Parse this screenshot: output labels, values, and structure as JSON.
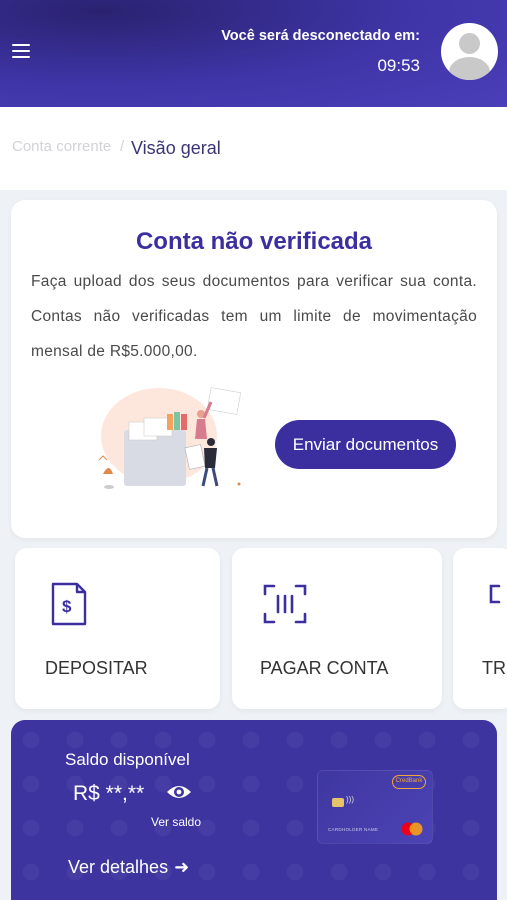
{
  "header": {
    "logout_label": "Você será desconectado em:",
    "timer": "09:53",
    "menu_icon": "hamburger-icon",
    "avatar_icon": "user-avatar-icon"
  },
  "breadcrumb": {
    "parent": "Conta corrente",
    "separator": "/",
    "current": "Visão geral"
  },
  "verification": {
    "title": "Conta não verificada",
    "text": "Faça upload dos seus documentos para verificar sua conta. Contas não verificadas tem um limite de movimentação mensal de R$5.000,00.",
    "button_label": "Enviar documentos"
  },
  "actions": [
    {
      "label": "DEPOSITAR",
      "icon": "deposit-document-icon"
    },
    {
      "label": "PAGAR CONTA",
      "icon": "barcode-scan-icon"
    },
    {
      "label": "TR",
      "icon": "transfer-icon"
    }
  ],
  "balance": {
    "label": "Saldo disponível",
    "value": "R$ **,**",
    "toggle_label": "Ver saldo",
    "details_label": "Ver detalhes",
    "card_brand": "CredBank",
    "card_holder": "CARDHOLDER NAME"
  },
  "colors": {
    "primary": "#3b2fa0",
    "header_bg": "#3f35a8",
    "background": "#eef1f5"
  }
}
